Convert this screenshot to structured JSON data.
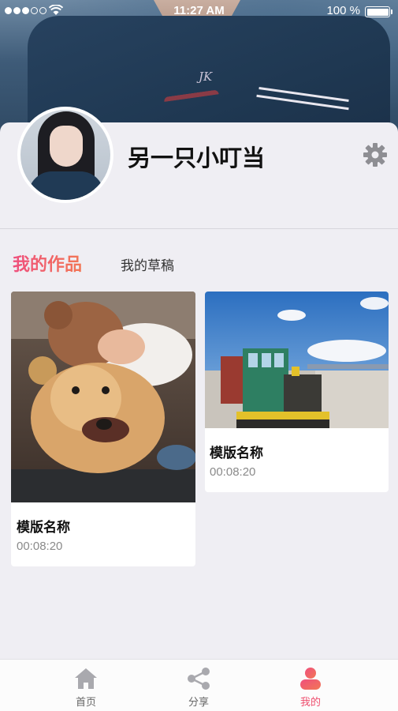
{
  "status_bar": {
    "time": "11:27 AM",
    "battery": "100 %",
    "signal_icon": "signal-dots-icon",
    "wifi_icon": "wifi-icon",
    "battery_icon": "battery-icon"
  },
  "profile": {
    "username": "另一只小叮当",
    "avatar": "avatar-photo",
    "settings_icon": "gear-icon"
  },
  "tabs": [
    {
      "label": "我的作品",
      "active": true
    },
    {
      "label": "我的草稿",
      "active": false
    }
  ],
  "works": [
    {
      "title": "模版名称",
      "duration": "00:08:20",
      "thumbnail": "girl-with-golden-retriever-photo"
    },
    {
      "title": "模版名称",
      "duration": "00:08:20",
      "thumbnail": "green-train-by-salt-lake-photo"
    }
  ],
  "tab_bar": {
    "items": [
      {
        "label": "首页",
        "icon": "home-icon",
        "active": false
      },
      {
        "label": "分享",
        "icon": "share-icon",
        "active": false
      },
      {
        "label": "我的",
        "icon": "person-icon",
        "active": true
      }
    ]
  },
  "colors": {
    "accent_start": "#ef4f7d",
    "accent_end": "#f27755",
    "background": "#efeef3",
    "inactive_icon": "#a9a9ae"
  }
}
